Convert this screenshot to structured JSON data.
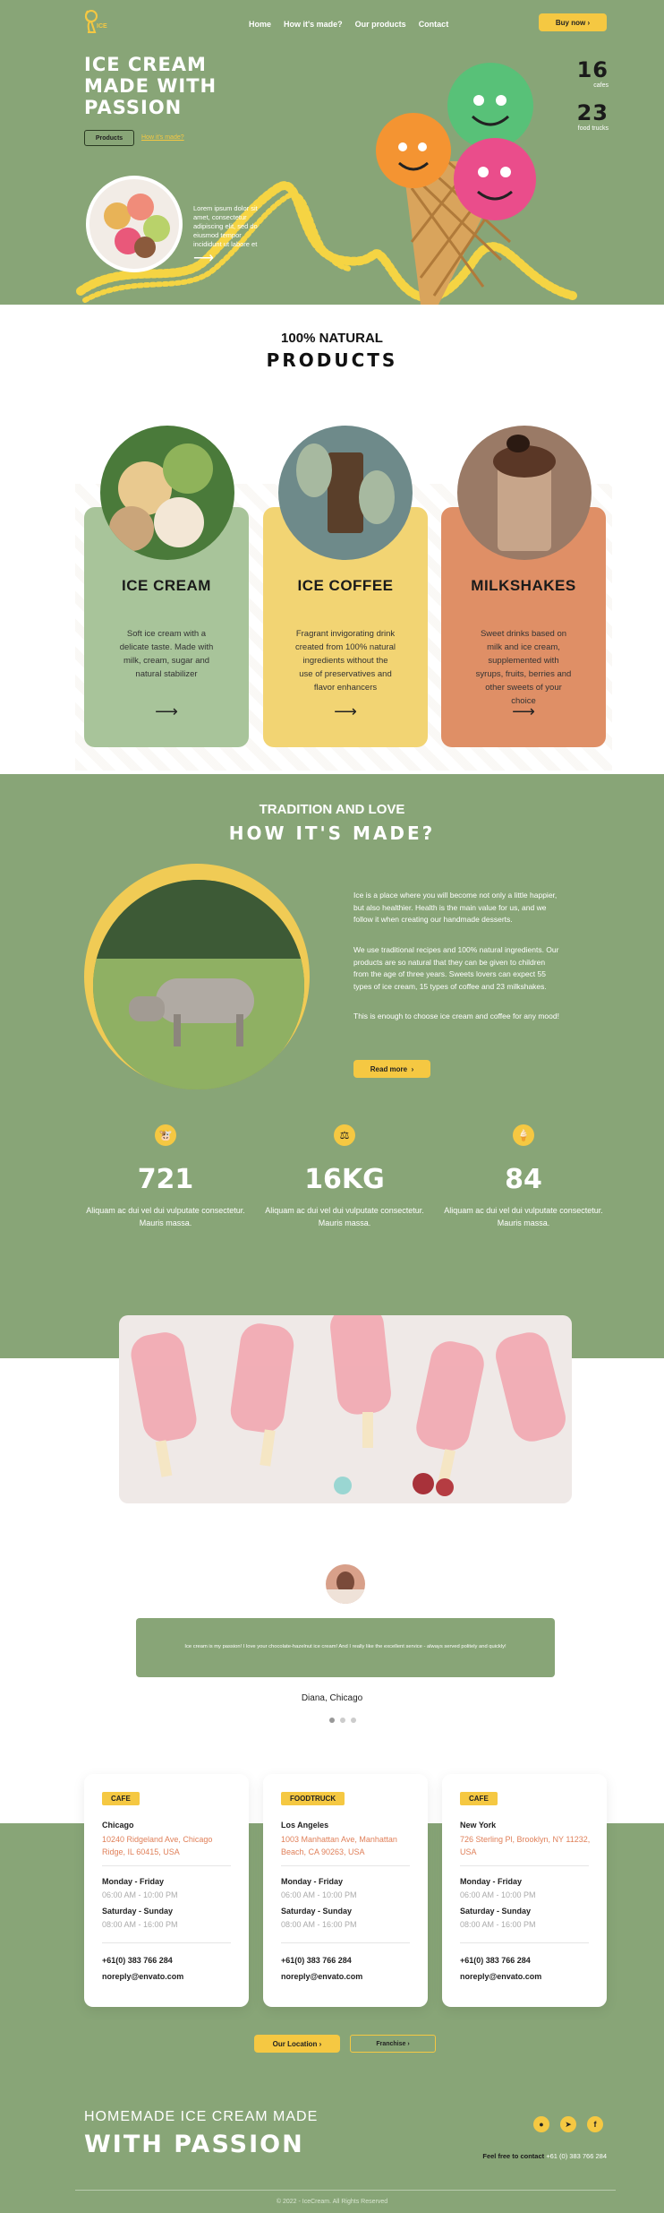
{
  "header": {
    "logo": "ICE",
    "nav": [
      "Home",
      "How it's made?",
      "Our products",
      "Contact"
    ],
    "buy_button": "Buy now"
  },
  "hero": {
    "title_lines": [
      "ICE CREAM",
      "MADE WITH",
      "PASSION"
    ],
    "products_button": "Products",
    "how_link": "How it's made?",
    "lorem": "Lorem ipsum dolor sit amet, consectetur adipiscing elit, sed do eiusmod tempor incididunt ut labore et",
    "stat1_num": "16",
    "stat1_label": "cafes",
    "stat2_num": "23",
    "stat2_label": "food trucks"
  },
  "products": {
    "kicker": "100% NATURAL",
    "title": "PRODUCTS",
    "items": [
      {
        "name": "ICE CREAM",
        "desc": "Soft ice cream with a delicate taste. Made with milk, cream, sugar and natural stabilizer",
        "color": "#a8c49a"
      },
      {
        "name": "ICE COFFEE",
        "desc": "Fragrant invigorating drink created from 100% natural ingredients without the use of preservatives and flavor enhancers",
        "color": "#f2d473"
      },
      {
        "name": "MILKSHAKES",
        "desc": "Sweet drinks based on milk and ice cream, supplemented with syrups, fruits, berries and other sweets of your choice",
        "color": "#df8f66"
      }
    ]
  },
  "how": {
    "kicker": "TRADITION AND LOVE",
    "title": "HOW IT'S MADE?",
    "para1": "Ice is a place where you will become not only a little happier, but also healthier. Health is the main value for us, and we follow it when creating our handmade desserts.",
    "para2": "We use traditional recipes and 100% natural ingredients. Our products are so natural that they can be given to children from the age of three years. Sweets lovers can expect 55 types of ice cream, 15 types of coffee and 23 milkshakes.",
    "para3": "This is enough to choose ice cream and coffee for any mood!",
    "read_more": "Read more",
    "stats": [
      {
        "num": "721",
        "label": "Aliquam ac dui vel dui vulputate consectetur. Mauris massa.",
        "icon": "cow-icon"
      },
      {
        "num": "16KG",
        "label": "Aliquam ac dui vel dui vulputate consectetur. Mauris massa.",
        "icon": "weight-icon"
      },
      {
        "num": "84",
        "label": "Aliquam ac dui vel dui vulputate consectetur. Mauris massa.",
        "icon": "ice-cream-icon"
      }
    ]
  },
  "testimonial": {
    "quote": "Ice cream is my passion! I love your chocolate-hazelnut ice cream! And I really like the excellent service - always served politely and quickly!",
    "author": "Diana, Chicago"
  },
  "locations": [
    {
      "tag": "CAFE",
      "city": "Chicago",
      "address": "10240 Ridgeland Ave, Chicago Ridge, IL 60415, USA",
      "wd": "Monday - Friday",
      "wd_hours": "06:00 AM - 10:00 PM",
      "we": "Saturday - Sunday",
      "we_hours": "08:00 AM - 16:00 PM",
      "phone": "+61(0) 383 766 284",
      "email": "noreply@envato.com"
    },
    {
      "tag": "FOODTRUCK",
      "city": "Los Angeles",
      "address": "1003 Manhattan Ave, Manhattan Beach, CA 90263, USA",
      "wd": "Monday - Friday",
      "wd_hours": "06:00 AM - 10:00 PM",
      "we": "Saturday - Sunday",
      "we_hours": "08:00 AM - 16:00 PM",
      "phone": "+61(0) 383 766 284",
      "email": "noreply@envato.com"
    },
    {
      "tag": "CAFE",
      "city": "New York",
      "address": "726 Sterling Pl, Brooklyn, NY 11232, USA",
      "wd": "Monday - Friday",
      "wd_hours": "06:00 AM - 10:00 PM",
      "we": "Saturday - Sunday",
      "we_hours": "08:00 AM - 16:00 PM",
      "phone": "+61(0) 383 766 284",
      "email": "noreply@envato.com"
    }
  ],
  "buttons": {
    "our_location": "Our Location",
    "franchise": "Franchise"
  },
  "footer": {
    "line1": "HOMEMADE ICE CREAM MADE",
    "line2": "WITH PASSION",
    "contact_label": "Feel free to contact",
    "contact_phone": "+61 (0) 383 766 284",
    "copyright": "© 2022 - IceCream. All Rights Reserved"
  },
  "colors": {
    "green": "#88a577",
    "yellow": "#f5c842",
    "orange": "#df8f66"
  }
}
